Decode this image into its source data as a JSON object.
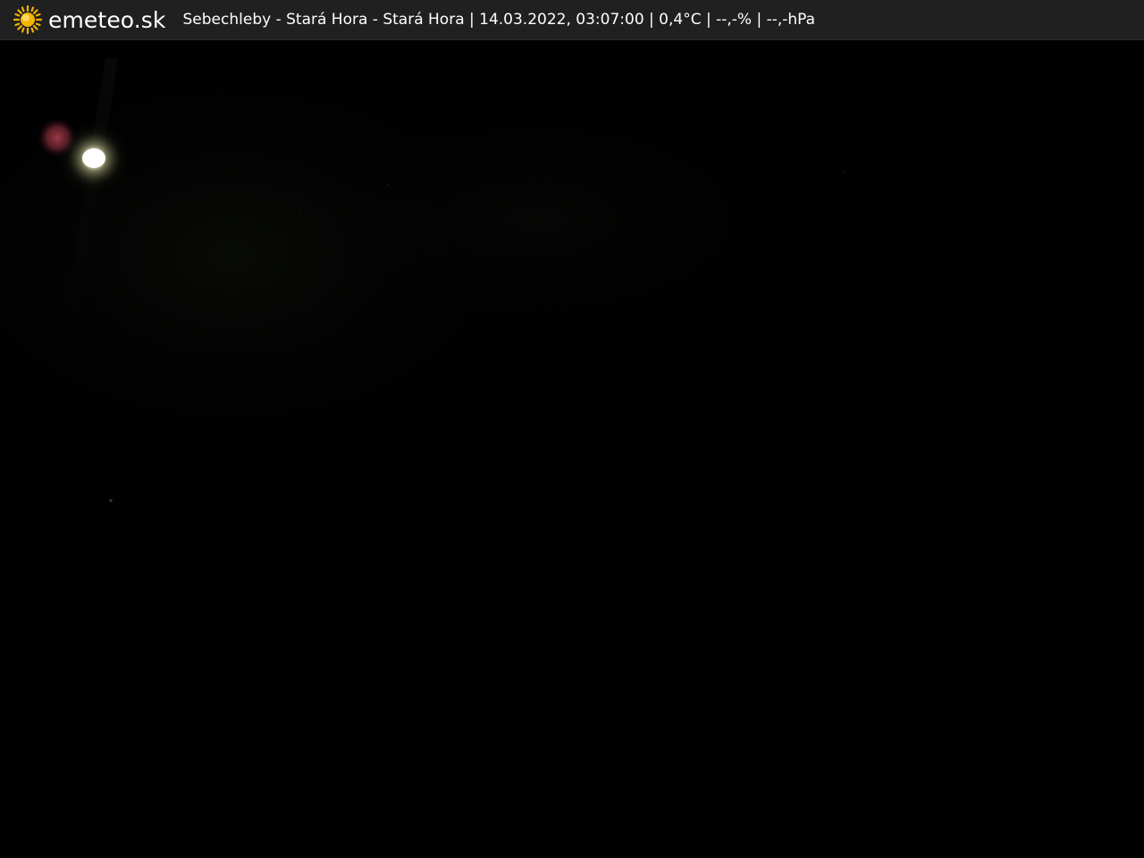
{
  "header": {
    "brand": "emeteo.sk",
    "logo_icon": "sun-icon",
    "caption": "Sebechleby - Stará Hora - Stará Hora | 14.03.2022, 03:07:00 | 0,4°C | --,-% | --,-hPa"
  },
  "colors": {
    "bar_background": "#202020",
    "sun_yellow": "#f5b400",
    "night_sky": "#010101"
  }
}
